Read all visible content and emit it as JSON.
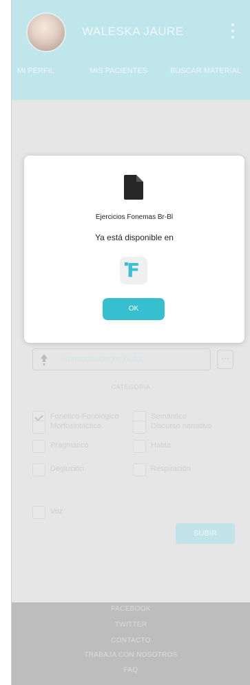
{
  "header": {
    "username": "WALESKA JAURE",
    "tabs": [
      "MI PERFIL",
      "MIS PACIENTES",
      "BUSCAR MATERIAL"
    ]
  },
  "upload": {
    "filename": "Pronunciacion_br_bl.doc",
    "more_label": "···"
  },
  "category": {
    "title": "CATEGORIA",
    "options": [
      {
        "label": "Fonético-Fonológico",
        "checked": true
      },
      {
        "label": "Semántico",
        "checked": false
      },
      {
        "label": "Morfosintáctico",
        "checked": false
      },
      {
        "label": "Discurso narrativo",
        "checked": false
      },
      {
        "label": "Pragmático",
        "checked": false
      },
      {
        "label": "Habla",
        "checked": false
      },
      {
        "label": "Deglución",
        "checked": false
      },
      {
        "label": "Respiración",
        "checked": false
      },
      {
        "label": "Voz",
        "checked": false
      }
    ]
  },
  "save_label": "SUBIR",
  "footer": {
    "links": [
      "FACEBOOK",
      "TWITTER",
      "CONTACTO",
      "TRABAJA CON NOSOTROS",
      "FAQ"
    ]
  },
  "dialog": {
    "title": "Ejercicios Fonemas Br-Bl",
    "message": "Ya está disponible en",
    "ok_label": "OK",
    "app_letter": "F"
  },
  "colors": {
    "accent": "#36bfcf",
    "header_bg": "#bfe6eb",
    "footer_bg": "#bdbdbd"
  }
}
